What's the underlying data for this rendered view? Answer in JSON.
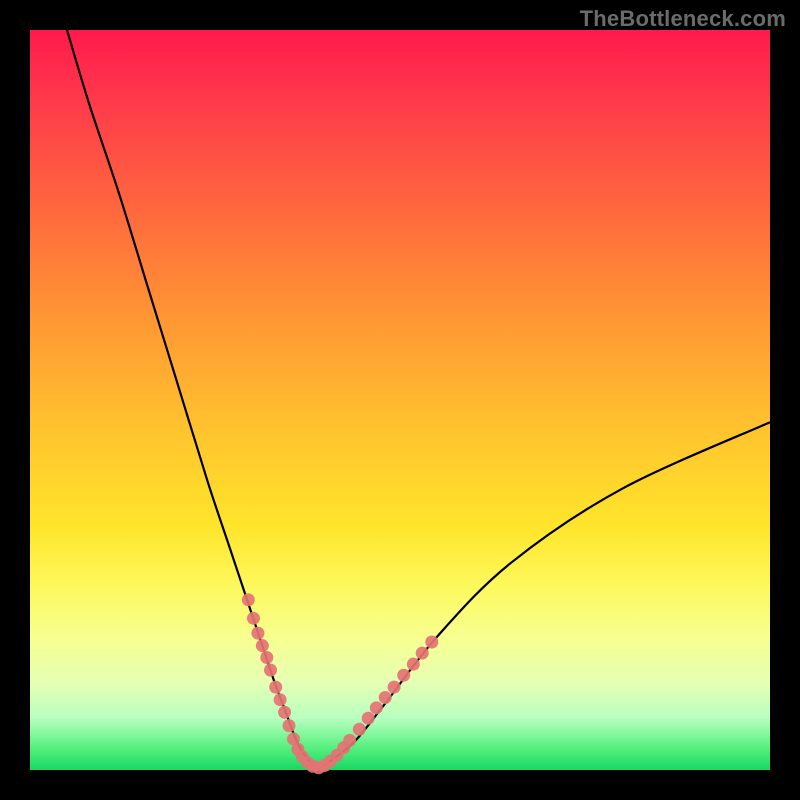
{
  "watermark": "TheBottleneck.com",
  "colors": {
    "frame": "#000000",
    "curve": "#000000",
    "marker": "#e57373",
    "gradient_top": "#ff1a4d",
    "gradient_bottom": "#17d864"
  },
  "chart_data": {
    "type": "line",
    "title": "",
    "xlabel": "",
    "ylabel": "",
    "xlim": [
      0,
      100
    ],
    "ylim": [
      0,
      100
    ],
    "series": [
      {
        "name": "bottleneck-curve",
        "x": [
          5,
          8,
          12,
          16,
          20,
          24,
          27,
          29,
          31,
          33,
          34.5,
          36,
          37.5,
          39,
          41,
          44,
          48,
          55,
          65,
          80,
          100
        ],
        "y": [
          100,
          90,
          78,
          65,
          52,
          39,
          30,
          24,
          18,
          12,
          8,
          4,
          1.5,
          0.3,
          1.5,
          4,
          9,
          18,
          28,
          38,
          47
        ]
      }
    ],
    "markers": {
      "name": "highlighted-points",
      "points": [
        {
          "x": 29.5,
          "y": 23
        },
        {
          "x": 30.2,
          "y": 20.5
        },
        {
          "x": 30.8,
          "y": 18.5
        },
        {
          "x": 31.4,
          "y": 16.8
        },
        {
          "x": 32.0,
          "y": 15.2
        },
        {
          "x": 32.5,
          "y": 13.5
        },
        {
          "x": 33.2,
          "y": 11.2
        },
        {
          "x": 33.8,
          "y": 9.5
        },
        {
          "x": 34.4,
          "y": 7.8
        },
        {
          "x": 35.0,
          "y": 6.0
        },
        {
          "x": 35.6,
          "y": 4.2
        },
        {
          "x": 36.2,
          "y": 2.8
        },
        {
          "x": 36.8,
          "y": 1.8
        },
        {
          "x": 37.5,
          "y": 1.0
        },
        {
          "x": 38.2,
          "y": 0.5
        },
        {
          "x": 39.0,
          "y": 0.3
        },
        {
          "x": 39.8,
          "y": 0.6
        },
        {
          "x": 40.6,
          "y": 1.2
        },
        {
          "x": 41.5,
          "y": 2.0
        },
        {
          "x": 42.4,
          "y": 3.0
        },
        {
          "x": 43.2,
          "y": 4.0
        },
        {
          "x": 44.5,
          "y": 5.5
        },
        {
          "x": 45.7,
          "y": 7.0
        },
        {
          "x": 46.8,
          "y": 8.4
        },
        {
          "x": 48.0,
          "y": 9.8
        },
        {
          "x": 49.2,
          "y": 11.2
        },
        {
          "x": 50.5,
          "y": 12.8
        },
        {
          "x": 51.8,
          "y": 14.3
        },
        {
          "x": 53.0,
          "y": 15.8
        },
        {
          "x": 54.3,
          "y": 17.3
        }
      ]
    }
  }
}
